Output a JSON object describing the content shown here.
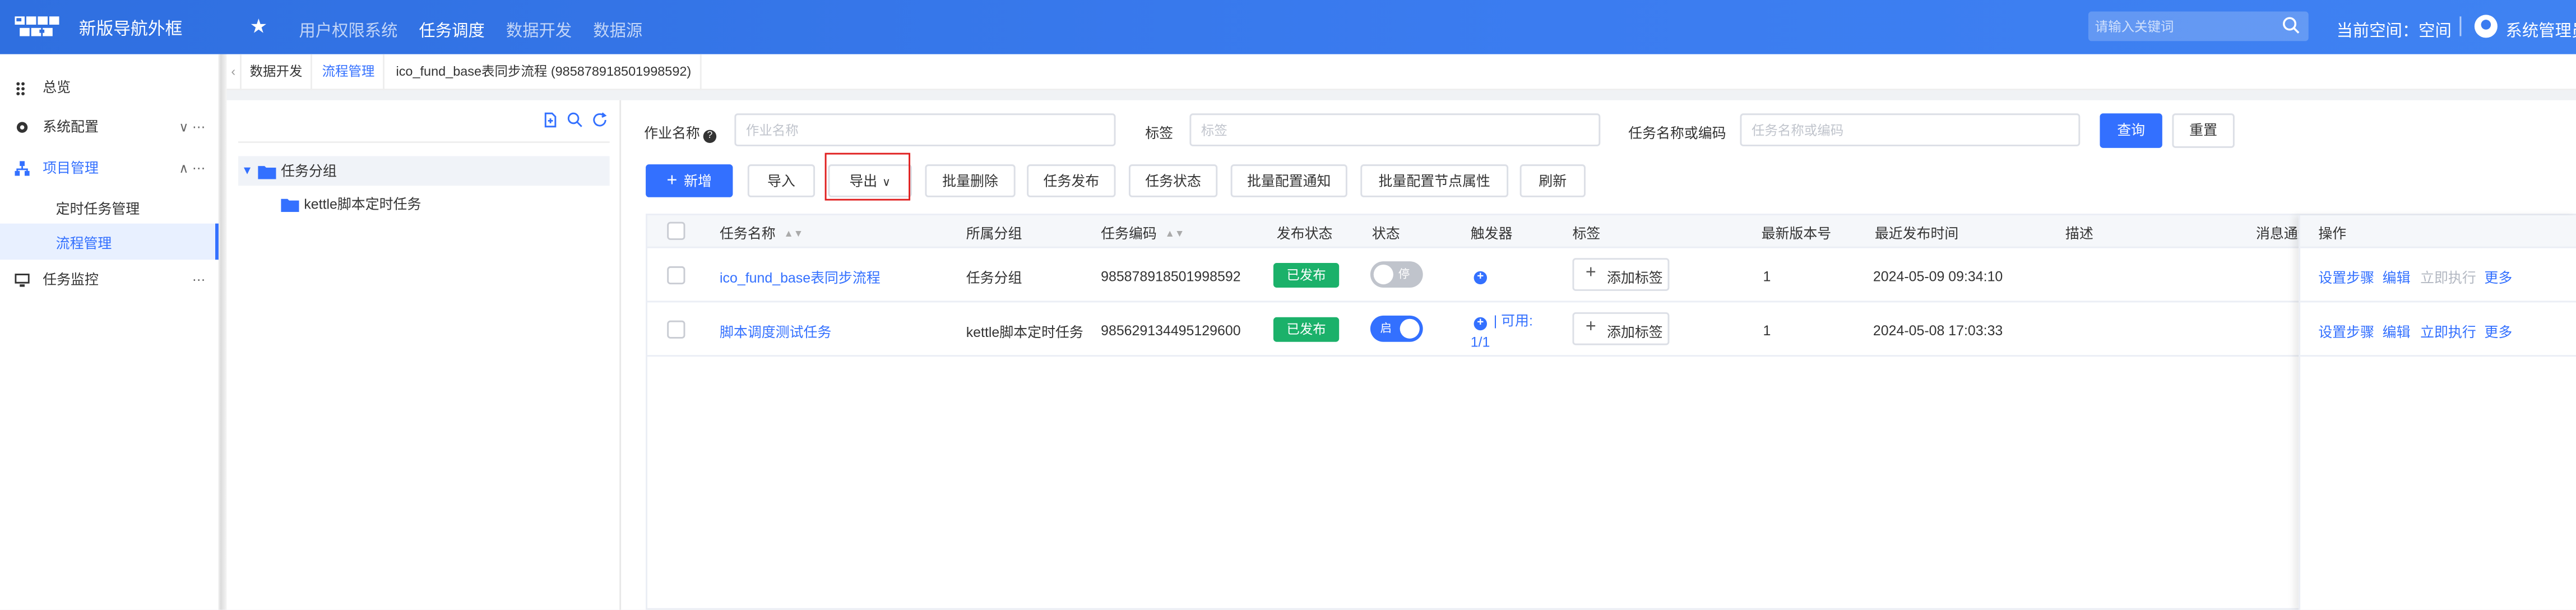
{
  "header": {
    "brand": "新版导航外框",
    "nav": [
      {
        "label": "用户权限系统",
        "active": false
      },
      {
        "label": "任务调度",
        "active": true
      },
      {
        "label": "数据开发",
        "active": false
      },
      {
        "label": "数据源",
        "active": false
      }
    ],
    "search_placeholder": "请输入关键词",
    "space_label": "当前空间：空间",
    "user_name": "系统管理员",
    "colors": {
      "header_bg": "#3b7cf0",
      "accent": "#3370ff"
    }
  },
  "sidebar": {
    "items": [
      {
        "label": "总览",
        "icon": "grid-icon"
      },
      {
        "label": "系统配置",
        "icon": "gear-icon",
        "tail": "∨ ⋯"
      },
      {
        "label": "项目管理",
        "icon": "project-icon",
        "tail": "∧ ⋯"
      },
      {
        "label": "任务监控",
        "icon": "monitor-icon",
        "tail": "⋯"
      }
    ],
    "sub_items": [
      {
        "label": "定时任务管理",
        "active": false
      },
      {
        "label": "流程管理",
        "active": true
      }
    ]
  },
  "breadcrumb": {
    "tabs": [
      {
        "label": "数据开发",
        "active": false
      },
      {
        "label": "流程管理",
        "active": true
      },
      {
        "label": "ico_fund_base表同步流程 (985878918501998592)",
        "active": false
      }
    ]
  },
  "tree": {
    "root": "任务分组",
    "children": [
      "kettle脚本定时任务"
    ]
  },
  "filters": {
    "job_name_label": "作业名称",
    "job_name_placeholder": "作业名称",
    "tag_label": "标签",
    "tag_placeholder": "标签",
    "task_label": "任务名称或编码",
    "task_placeholder": "任务名称或编码",
    "query_btn": "查询",
    "reset_btn": "重置"
  },
  "toolbar": {
    "add": "新增",
    "import": "导入",
    "export": "导出",
    "batch_delete": "批量删除",
    "publish": "任务发布",
    "status": "任务状态",
    "batch_notify": "批量配置通知",
    "batch_node": "批量配置节点属性",
    "refresh": "刷新"
  },
  "table": {
    "columns": [
      "任务名称",
      "所属分组",
      "任务编码",
      "发布状态",
      "状态",
      "触发器",
      "标签",
      "最新版本号",
      "最近发布时间",
      "描述",
      "消息通知",
      "操作"
    ],
    "rows": [
      {
        "name": "ico_fund_base表同步流程",
        "group": "任务分组",
        "code": "985878918501998592",
        "publish": "已发布",
        "status_on": false,
        "status_text": "停",
        "trigger": "",
        "add_tag": "添加标签",
        "version": "1",
        "published_at": "2024-05-09 09:34:10",
        "desc": ""
      },
      {
        "name": "脚本调度测试任务",
        "group": "kettle脚本定时任务",
        "code": "985629134495129600",
        "publish": "已发布",
        "status_on": true,
        "status_text": "启",
        "trigger": "| 可用: 1/1",
        "trigger_a": "| 可用:",
        "trigger_b": "1/1",
        "add_tag": "添加标签",
        "version": "1",
        "published_at": "2024-05-08 17:03:33",
        "desc": ""
      }
    ],
    "ops": [
      "设置步骤",
      "编辑",
      "立即执行",
      "更多"
    ]
  }
}
